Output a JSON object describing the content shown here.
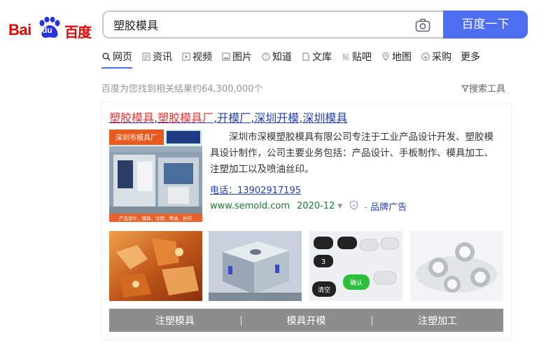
{
  "logo": {
    "latin": "Bai",
    "paw_text": "du",
    "cn": "百度"
  },
  "search": {
    "value": "塑胶模具",
    "button_label": "百度一下"
  },
  "tabs": [
    {
      "label": "网页",
      "icon": "search-icon",
      "active": true
    },
    {
      "label": "资讯",
      "icon": "news-icon"
    },
    {
      "label": "视频",
      "icon": "video-icon"
    },
    {
      "label": "图片",
      "icon": "image-icon"
    },
    {
      "label": "知道",
      "icon": "question-icon"
    },
    {
      "label": "文库",
      "icon": "document-icon"
    },
    {
      "label": "贴吧",
      "icon": "tieba-icon"
    },
    {
      "label": "地图",
      "icon": "map-icon"
    },
    {
      "label": "采购",
      "icon": "purchase-icon"
    },
    {
      "label": "更多"
    }
  ],
  "results_meta": {
    "count_text": "百度为您找到相关结果约64,300,000个",
    "tools_label": "搜索工具"
  },
  "result": {
    "title_parts": [
      "塑胶模具",
      ",",
      "塑胶模具厂",
      ",开模厂,深圳开模,深圳模具"
    ],
    "thumb_caption_top": "深圳市模具厂",
    "thumb_caption_bottom": "产品设计、模具、注塑、喷油、丝印",
    "description": "深圳市深模塑胶模具有限公司专注于工业产品设计开发、塑胶模具设计制作，公司主要业务包括：产品设计、手板制作、模具加工、注塑加工以及喷油丝印。",
    "phone": "电话：13902917195",
    "url": "www.semold.com",
    "date": "2020-12",
    "ad_prefix": "-",
    "ad_label": "品牌广告",
    "sitelinks": [
      "注塑模具",
      "模具开模",
      "注塑加工"
    ]
  },
  "colors": {
    "brand_red": "#e10601",
    "brand_blue": "#4e6ef2",
    "link": "#2440b3",
    "highlight": "#f73131",
    "url_green": "#1a7b30"
  }
}
